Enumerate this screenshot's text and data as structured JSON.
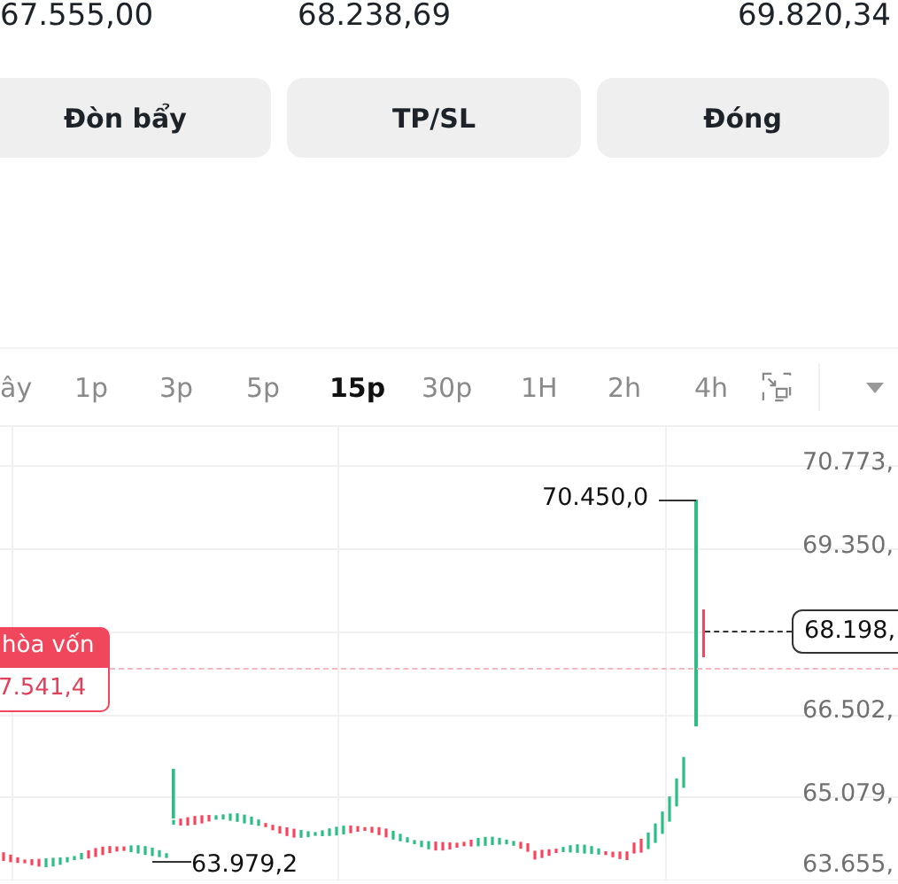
{
  "prices": [
    "67.555,00",
    "68.238,69",
    "69.820,34"
  ],
  "buttons": [
    "Đòn bẩy",
    "TP/SL",
    "Đóng"
  ],
  "intervals": [
    {
      "label": "ây",
      "selected": false
    },
    {
      "label": "1p",
      "selected": false
    },
    {
      "label": "3p",
      "selected": false
    },
    {
      "label": "5p",
      "selected": false
    },
    {
      "label": "15p",
      "selected": true
    },
    {
      "label": "30p",
      "selected": false
    },
    {
      "label": "1H",
      "selected": false
    },
    {
      "label": "2h",
      "selected": false
    },
    {
      "label": "4h",
      "selected": false
    }
  ],
  "chart": {
    "price_axis": [
      "70.773,",
      "69.350,",
      "66.502,",
      "65.079,",
      "63.655,"
    ],
    "high_label": "70.450,0",
    "low_label": "63.979,2",
    "current_price": "68.198,",
    "break_even": {
      "label": "hòa vốn",
      "price": "7.541,4"
    }
  }
}
